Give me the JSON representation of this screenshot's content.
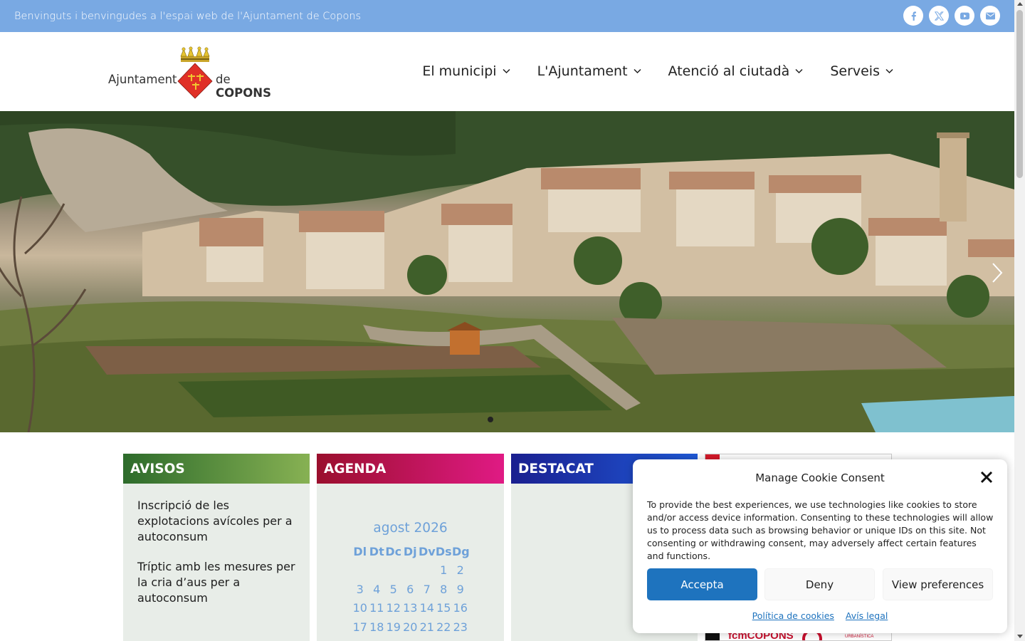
{
  "topbar": {
    "welcome": "Benvinguts i benvingudes a l'espai web de l'Ajuntament de Copons",
    "social": [
      "facebook-icon",
      "x-icon",
      "youtube-icon",
      "email-icon"
    ]
  },
  "logo": {
    "word1": "Ajuntament",
    "word2_prefix": "de ",
    "word2_bold": "COPONS"
  },
  "nav": {
    "items": [
      {
        "label": "El municipi"
      },
      {
        "label": "L'Ajuntament"
      },
      {
        "label": "Atenció al ciutadà"
      },
      {
        "label": "Serveis"
      }
    ]
  },
  "avisos": {
    "title": "AVISOS",
    "items": [
      "Inscripció de les explotacions avícoles per a autoconsum",
      "Tríptic amb les mesures per la cria d’aus per a autoconsum"
    ]
  },
  "agenda": {
    "title": "AGENDA",
    "month": "agost 2026",
    "weekdays": [
      "Dl",
      "Dt",
      "Dc",
      "Dj",
      "Dv",
      "Ds",
      "Dg"
    ],
    "weeks": [
      [
        "",
        "",
        "",
        "",
        "",
        "1",
        "2"
      ],
      [
        "3",
        "4",
        "5",
        "6",
        "7",
        "8",
        "9"
      ],
      [
        "10",
        "11",
        "12",
        "13",
        "14",
        "15",
        "16"
      ],
      [
        "17",
        "18",
        "19",
        "20",
        "21",
        "22",
        "23"
      ]
    ]
  },
  "destacat": {
    "title": "DESTACAT"
  },
  "side_banner": {
    "bottom_text": "fcmCOPONS",
    "small_text": "URBANÍSTICA"
  },
  "cookie": {
    "title": "Manage Cookie Consent",
    "body": "To provide the best experiences, we use technologies like cookies to store and/or access device information. Consenting to these technologies will allow us to process data such as browsing behavior or unique IDs on this site. Not consenting or withdrawing consent, may adversely affect certain features and functions.",
    "accept": "Accepta",
    "deny": "Deny",
    "prefs": "View preferences",
    "link_cookies": "Política de cookies",
    "link_legal": "Avís legal"
  },
  "colors": {
    "topbar": "#79a9e3",
    "accept": "#1e73be",
    "calendar": "#6ea1d9"
  }
}
